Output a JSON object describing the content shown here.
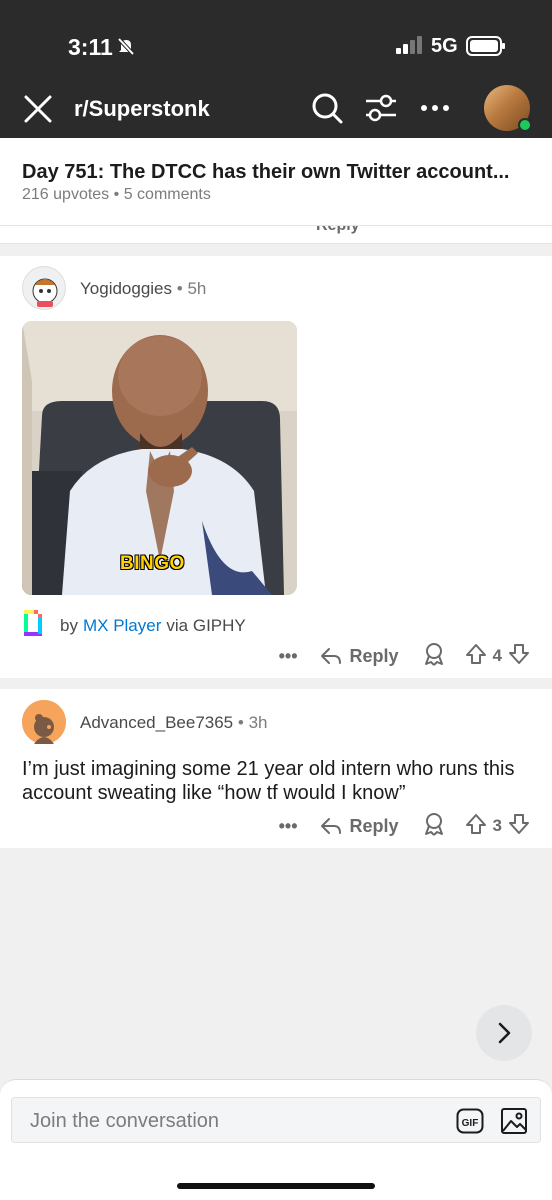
{
  "status_bar": {
    "time": "3:11",
    "network": "5G"
  },
  "nav": {
    "subreddit": "r/Superstonk"
  },
  "post": {
    "title": "Day 751: The DTCC has their own Twitter account...",
    "upvotes": "216 upvotes",
    "separator": "•",
    "comments": "5 comments"
  },
  "peek": {
    "reply_label": "Reply"
  },
  "comments": [
    {
      "username": "Yogidoggies",
      "separator": "•",
      "time_ago": "5h",
      "gif_caption": "BINGO",
      "credit": {
        "by": "by",
        "author": "MX Player",
        "via": "via GIPHY"
      },
      "actions": {
        "more": "•••",
        "reply": "Reply",
        "score": "4"
      }
    },
    {
      "username": "Advanced_Bee7365",
      "separator": "•",
      "time_ago": "3h",
      "text": "I’m just imagining some 21 year old intern who runs this account sweating like “how tf would I know”",
      "actions": {
        "more": "•••",
        "reply": "Reply",
        "score": "3"
      }
    }
  ],
  "composer": {
    "placeholder": "Join the conversation",
    "gif_label": "GIF"
  },
  "colors": {
    "header_bg": "#2b2b2b",
    "link_blue": "#0079d3",
    "online_green": "#1fc85a",
    "caption_yellow": "#ffd200"
  }
}
